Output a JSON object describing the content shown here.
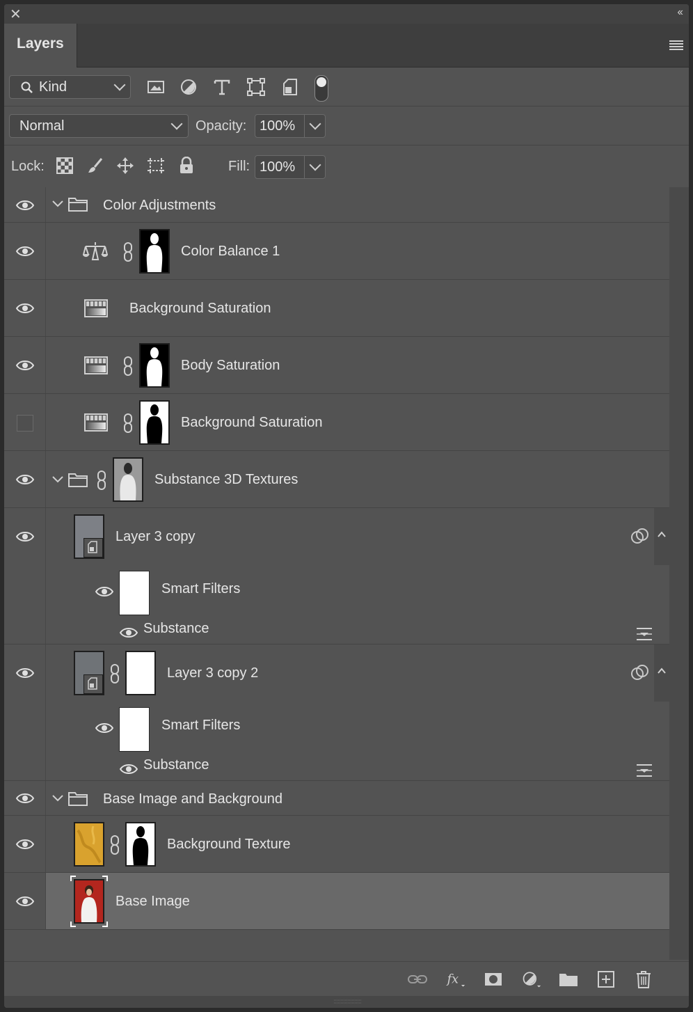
{
  "panel": {
    "tab_title": "Layers"
  },
  "filter": {
    "kind_label": "Kind"
  },
  "blend": {
    "mode": "Normal",
    "opacity_label": "Opacity:",
    "opacity_value": "100%"
  },
  "lock": {
    "label": "Lock:",
    "fill_label": "Fill:",
    "fill_value": "100%"
  },
  "layers": [
    {
      "name": "Color Adjustments",
      "type": "group",
      "visible": true
    },
    {
      "name": "Color Balance 1",
      "type": "adjustment",
      "visible": true
    },
    {
      "name": "Background Saturation",
      "type": "adjustment",
      "visible": true
    },
    {
      "name": "Body Saturation",
      "type": "adjustment",
      "visible": true
    },
    {
      "name": "Background Saturation",
      "type": "adjustment",
      "visible": false
    },
    {
      "name": "Substance 3D Textures",
      "type": "group",
      "visible": true
    },
    {
      "name": "Layer 3 copy",
      "type": "smart-object",
      "visible": true,
      "smart_filters_label": "Smart Filters",
      "filter_name": "Substance"
    },
    {
      "name": "Layer 3 copy 2",
      "type": "smart-object",
      "visible": true,
      "smart_filters_label": "Smart Filters",
      "filter_name": "Substance"
    },
    {
      "name": "Base Image and Background",
      "type": "group",
      "visible": true
    },
    {
      "name": "Background Texture",
      "type": "pixel",
      "visible": true
    },
    {
      "name": "Base Image",
      "type": "pixel",
      "visible": true,
      "selected": true
    }
  ]
}
